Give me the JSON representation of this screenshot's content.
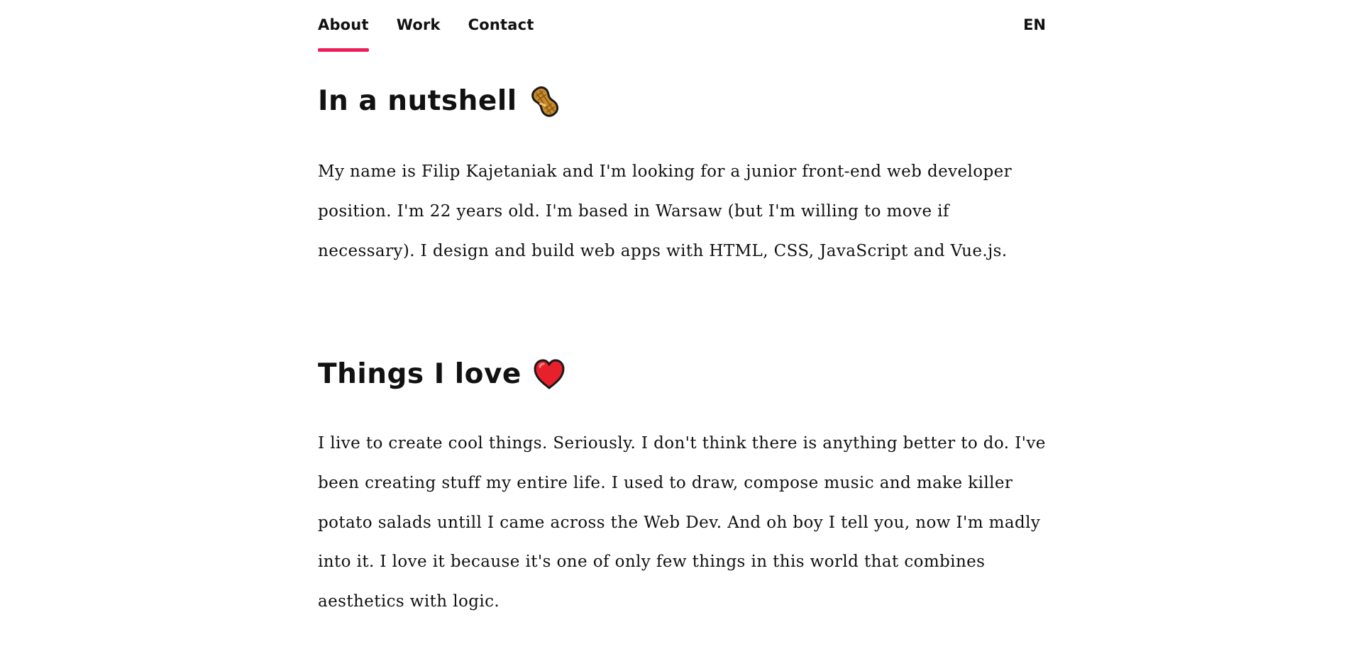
{
  "nav": {
    "links": [
      {
        "label": "About",
        "active": true
      },
      {
        "label": "Work",
        "active": false
      },
      {
        "label": "Contact",
        "active": false
      }
    ],
    "language": "EN",
    "accent_color": "#ef1d57"
  },
  "sections": [
    {
      "heading": "In a nutshell",
      "icon": "peanut-icon",
      "text": "My name is Filip Kajetaniak and I'm looking for a junior front-end web developer position. I'm 22 years old. I'm based in Warsaw (but I'm willing to move if necessary). I design and build web apps with HTML, CSS, JavaScript and Vue.js."
    },
    {
      "heading": "Things I love",
      "icon": "heart-icon",
      "text": "I live to create cool things. Seriously. I don't think there is anything better to do. I've been creating stuff my entire life. I used to draw, compose music and make killer potato salads untill I came across the Web Dev. And oh boy I tell you, now I'm madly into it. I love it because it's one of only few things in this world that combines aesthetics with logic."
    }
  ]
}
